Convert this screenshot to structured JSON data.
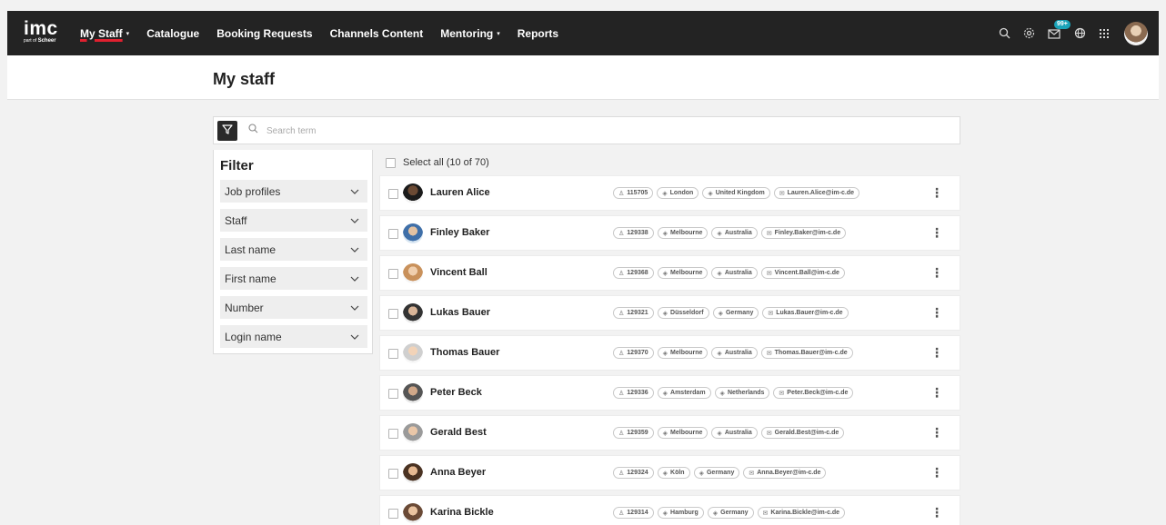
{
  "app": {
    "logo_main": "imc",
    "logo_sub_prefix": "part of",
    "logo_sub_brand": "Scheer"
  },
  "nav": {
    "items": [
      {
        "label": "My Staff",
        "caret": "▾"
      },
      {
        "label": "Catalogue"
      },
      {
        "label": "Booking Requests"
      },
      {
        "label": "Channels Content"
      },
      {
        "label": "Mentoring",
        "caret": "▾"
      },
      {
        "label": "Reports"
      }
    ],
    "notification_badge": "99+",
    "icons": [
      "search-icon",
      "settings-icon",
      "mail-icon",
      "globe-icon",
      "apps-grid-icon",
      "user-avatar"
    ]
  },
  "page": {
    "title": "My staff"
  },
  "search": {
    "placeholder": "Search term",
    "value": ""
  },
  "filter": {
    "title": "Filter",
    "items": [
      "Job profiles",
      "Staff",
      "Last name",
      "First name",
      "Number",
      "Login name"
    ]
  },
  "list": {
    "select_all_label": "Select all (10 of 70)",
    "rows": [
      {
        "name": "Lauren Alice",
        "number": "115705",
        "city": "London",
        "country": "United Kingdom",
        "email": "Lauren.Alice@im-c.de"
      },
      {
        "name": "Finley Baker",
        "number": "129338",
        "city": "Melbourne",
        "country": "Australia",
        "email": "Finley.Baker@im-c.de"
      },
      {
        "name": "Vincent Ball",
        "number": "129368",
        "city": "Melbourne",
        "country": "Australia",
        "email": "Vincent.Ball@im-c.de"
      },
      {
        "name": "Lukas Bauer",
        "number": "129321",
        "city": "Düsseldorf",
        "country": "Germany",
        "email": "Lukas.Bauer@im-c.de"
      },
      {
        "name": "Thomas Bauer",
        "number": "129370",
        "city": "Melbourne",
        "country": "Australia",
        "email": "Thomas.Bauer@im-c.de"
      },
      {
        "name": "Peter Beck",
        "number": "129336",
        "city": "Amsterdam",
        "country": "Netherlands",
        "email": "Peter.Beck@im-c.de"
      },
      {
        "name": "Gerald Best",
        "number": "129359",
        "city": "Melbourne",
        "country": "Australia",
        "email": "Gerald.Best@im-c.de"
      },
      {
        "name": "Anna Beyer",
        "number": "129324",
        "city": "Köln",
        "country": "Germany",
        "email": "Anna.Beyer@im-c.de"
      },
      {
        "name": "Karina Bickle",
        "number": "129314",
        "city": "Hamburg",
        "country": "Germany",
        "email": "Karina.Bickle@im-c.de"
      }
    ]
  },
  "colors": {
    "topbar_bg": "#232323",
    "active_underline": "#e0202f",
    "badge_bg": "#1aa3b8",
    "page_bg": "#f2f2f2"
  }
}
